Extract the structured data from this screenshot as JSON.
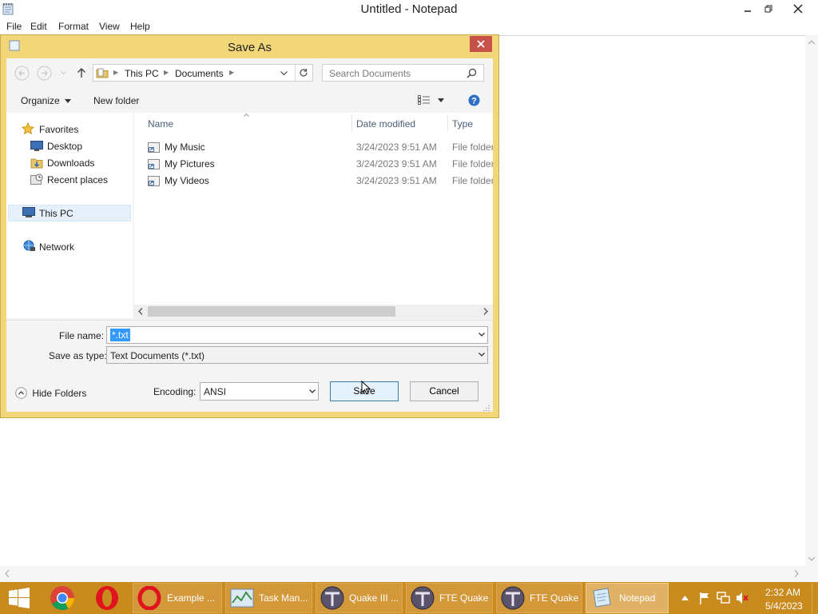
{
  "notepad": {
    "title": "Untitled - Notepad",
    "menu": [
      "File",
      "Edit",
      "Format",
      "View",
      "Help"
    ]
  },
  "dialog": {
    "title": "Save As",
    "breadcrumb": [
      "This PC",
      "Documents"
    ],
    "search_placeholder": "Search Documents",
    "organize_label": "Organize",
    "new_folder_label": "New folder",
    "nav": {
      "favorites": "Favorites",
      "desktop": "Desktop",
      "downloads": "Downloads",
      "recent": "Recent places",
      "this_pc": "This PC",
      "network": "Network"
    },
    "columns": {
      "name": "Name",
      "date": "Date modified",
      "type": "Type"
    },
    "files": [
      {
        "name": "My Music",
        "date": "3/24/2023 9:51 AM",
        "type": "File folder"
      },
      {
        "name": "My Pictures",
        "date": "3/24/2023 9:51 AM",
        "type": "File folder"
      },
      {
        "name": "My Videos",
        "date": "3/24/2023 9:51 AM",
        "type": "File folder"
      }
    ],
    "file_name_label": "File name:",
    "file_name_value": "*.txt",
    "save_type_label": "Save as type:",
    "save_type_value": "Text Documents (*.txt)",
    "hide_folders_label": "Hide Folders",
    "encoding_label": "Encoding:",
    "encoding_value": "ANSI",
    "save_label": "Save",
    "cancel_label": "Cancel"
  },
  "taskbar": {
    "items": [
      "Example ...",
      "Task Man...",
      "Quake III ...",
      "FTE Quake",
      "FTE Quake",
      "Notepad"
    ],
    "time": "2:32 AM",
    "date": "5/4/2023"
  },
  "colors": {
    "dialog_frame": "#f1d778",
    "close_button": "#c7514b",
    "taskbar": "#c98a1e",
    "selection": "#3399ff"
  }
}
